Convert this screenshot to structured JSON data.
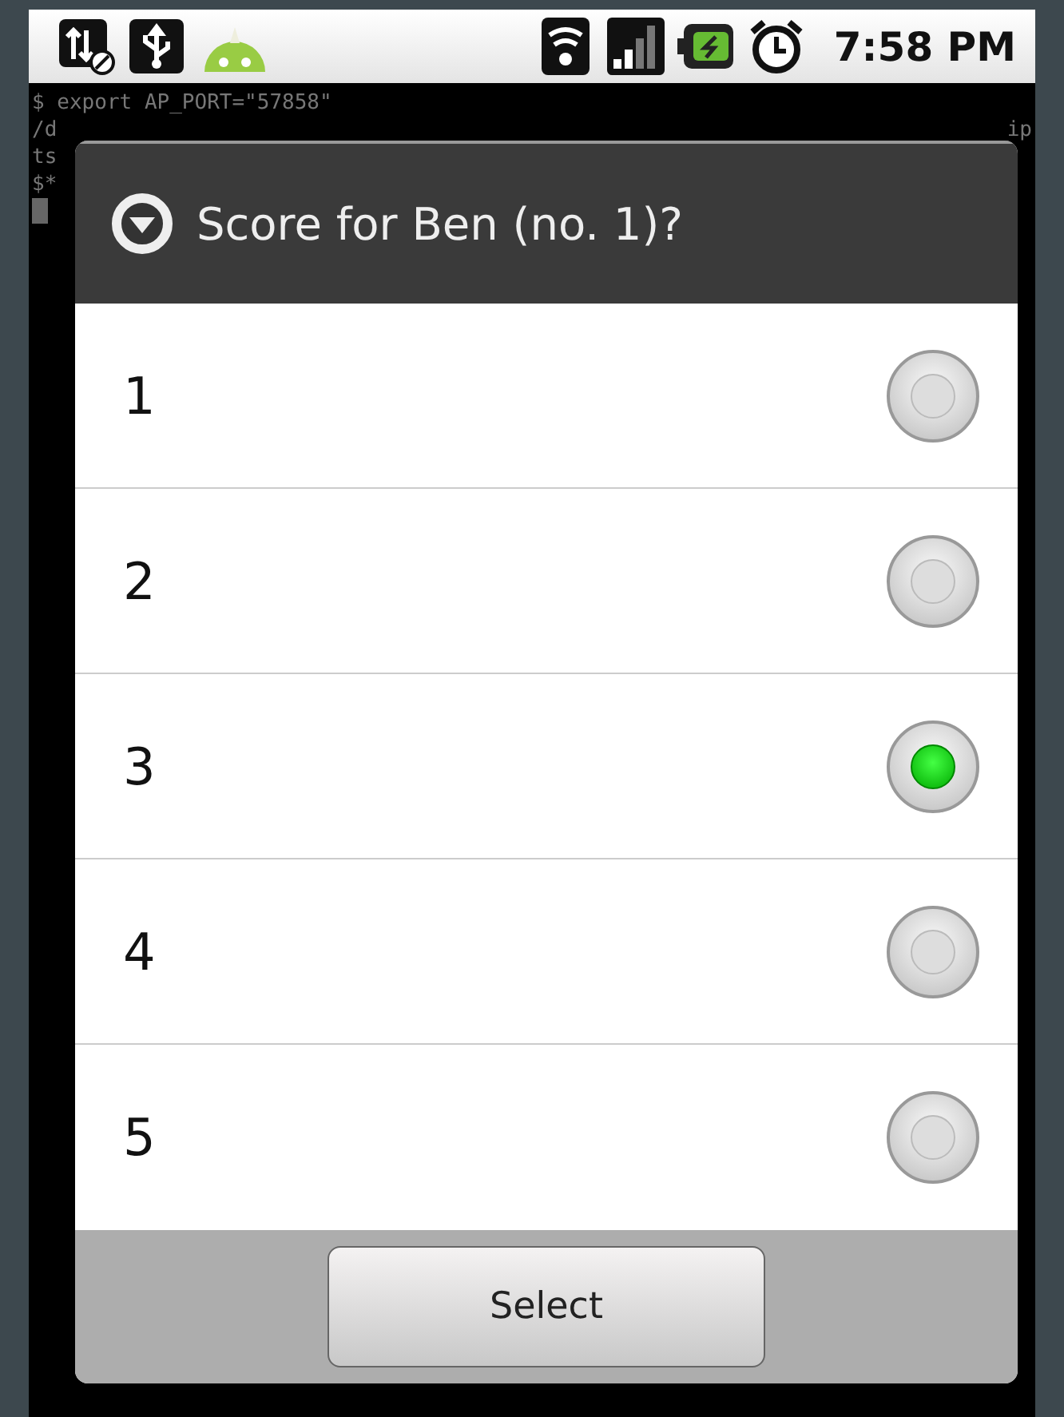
{
  "status_bar": {
    "time": "7:58 PM"
  },
  "terminal": {
    "lines": [
      {
        "text": "$ export AP_PORT=\"57858\""
      },
      {
        "text": "/d",
        "tail": "ip"
      },
      {
        "text": "ts"
      },
      {
        "text": "$*"
      }
    ],
    "cursor": true
  },
  "dialog": {
    "title": "Score for Ben (no. 1)?",
    "options": [
      {
        "label": "1",
        "selected": false
      },
      {
        "label": "2",
        "selected": false
      },
      {
        "label": "3",
        "selected": true
      },
      {
        "label": "4",
        "selected": false
      },
      {
        "label": "5",
        "selected": false
      }
    ],
    "buttons": [
      "Select"
    ]
  }
}
